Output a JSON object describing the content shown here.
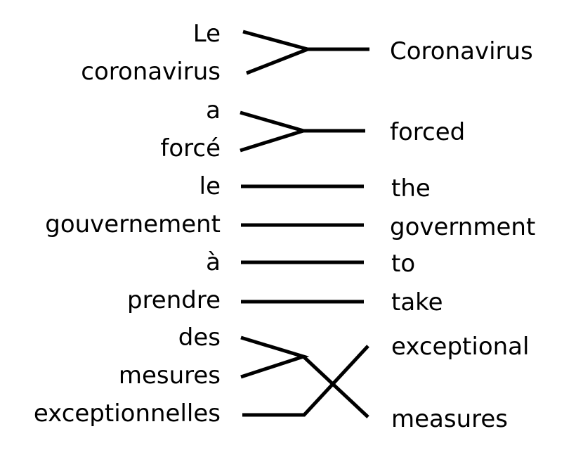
{
  "diagram": {
    "type": "word-alignment",
    "source_words": [
      "Le",
      "coronavirus",
      "a",
      "forcé",
      "le",
      "gouvernement",
      "à",
      "prendre",
      "des",
      "mesures",
      "exceptionnelles"
    ],
    "target_words": [
      "Coronavirus",
      "forced",
      "the",
      "government",
      "to",
      "take",
      "exceptional",
      "measures"
    ],
    "alignments": [
      {
        "source": [
          "Le",
          "coronavirus"
        ],
        "target": [
          "Coronavirus"
        ]
      },
      {
        "source": [
          "a",
          "forcé"
        ],
        "target": [
          "forced"
        ]
      },
      {
        "source": [
          "le"
        ],
        "target": [
          "the"
        ]
      },
      {
        "source": [
          "gouvernement"
        ],
        "target": [
          "government"
        ]
      },
      {
        "source": [
          "à"
        ],
        "target": [
          "to"
        ]
      },
      {
        "source": [
          "prendre"
        ],
        "target": [
          "take"
        ]
      },
      {
        "source": [
          "des",
          "mesures"
        ],
        "target": [
          "measures"
        ]
      },
      {
        "source": [
          "exceptionnelles"
        ],
        "target": [
          "exceptional"
        ]
      }
    ]
  }
}
